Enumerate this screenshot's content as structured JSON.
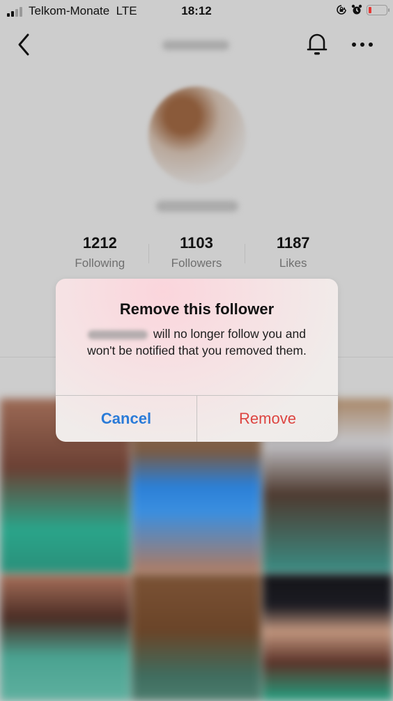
{
  "status_bar": {
    "carrier": "Telkom-Monate",
    "network": "LTE",
    "time": "18:12",
    "signal_bars_active": 2,
    "signal_bars_total": 4,
    "battery_level": 0.1,
    "icons": [
      "rotation-lock-icon",
      "alarm-icon",
      "battery-icon"
    ],
    "battery_color": "#e53935"
  },
  "nav": {
    "back_icon": "chevron-left-icon",
    "title": "",
    "bell_icon": "bell-icon",
    "more_icon": "more-horizontal-icon"
  },
  "profile": {
    "stats": [
      {
        "value": "1212",
        "label": "Following"
      },
      {
        "value": "1103",
        "label": "Followers"
      },
      {
        "value": "1187",
        "label": "Likes"
      }
    ]
  },
  "dialog": {
    "title": "Remove this follower",
    "message": "will no longer follow you and won't be notified that you removed them.",
    "cancel_label": "Cancel",
    "remove_label": "Remove",
    "cancel_color": "#2a7bd8",
    "remove_color": "#dd4440"
  },
  "videos": {
    "count": 6
  }
}
